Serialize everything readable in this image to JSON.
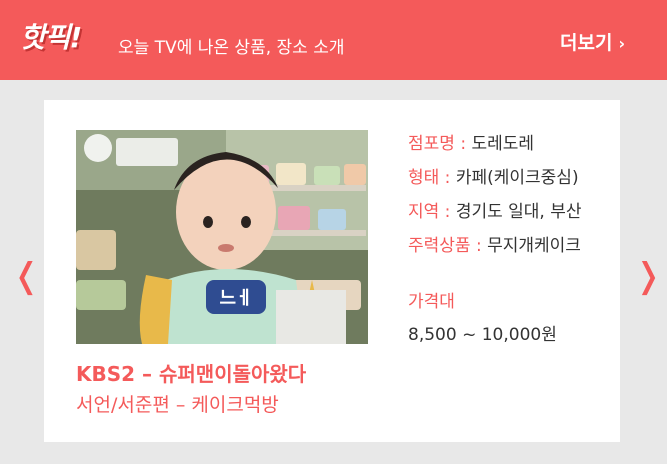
{
  "header": {
    "logo": "핫픽!",
    "tagline": "오늘 TV에 나온 상품, 장소 소개",
    "more_label": "더보기",
    "more_icon": "chevron-right-icon",
    "colors": {
      "accent": "#f45a5a"
    }
  },
  "card": {
    "info": [
      {
        "key": "점포명 :",
        "value": "도레도레"
      },
      {
        "key": "형태 :",
        "value": "카페(케이크중심)"
      },
      {
        "key": "지역 :",
        "value": "경기도 일대, 부산"
      },
      {
        "key": "주력상품 :",
        "value": "무지개케이크"
      }
    ],
    "price_label": "가격대",
    "price_value": "8,500 ~ 10,000원",
    "show_title": "KBS2 – 슈퍼맨이돌아왔다",
    "show_subtitle": "서언/서준편 – 케이크먹방",
    "thumbnail_caption": "느ㅔ"
  },
  "nav": {
    "prev_icon": "chevron-left-icon",
    "next_icon": "chevron-right-icon",
    "prev_glyph": "❬",
    "next_glyph": "❭"
  }
}
